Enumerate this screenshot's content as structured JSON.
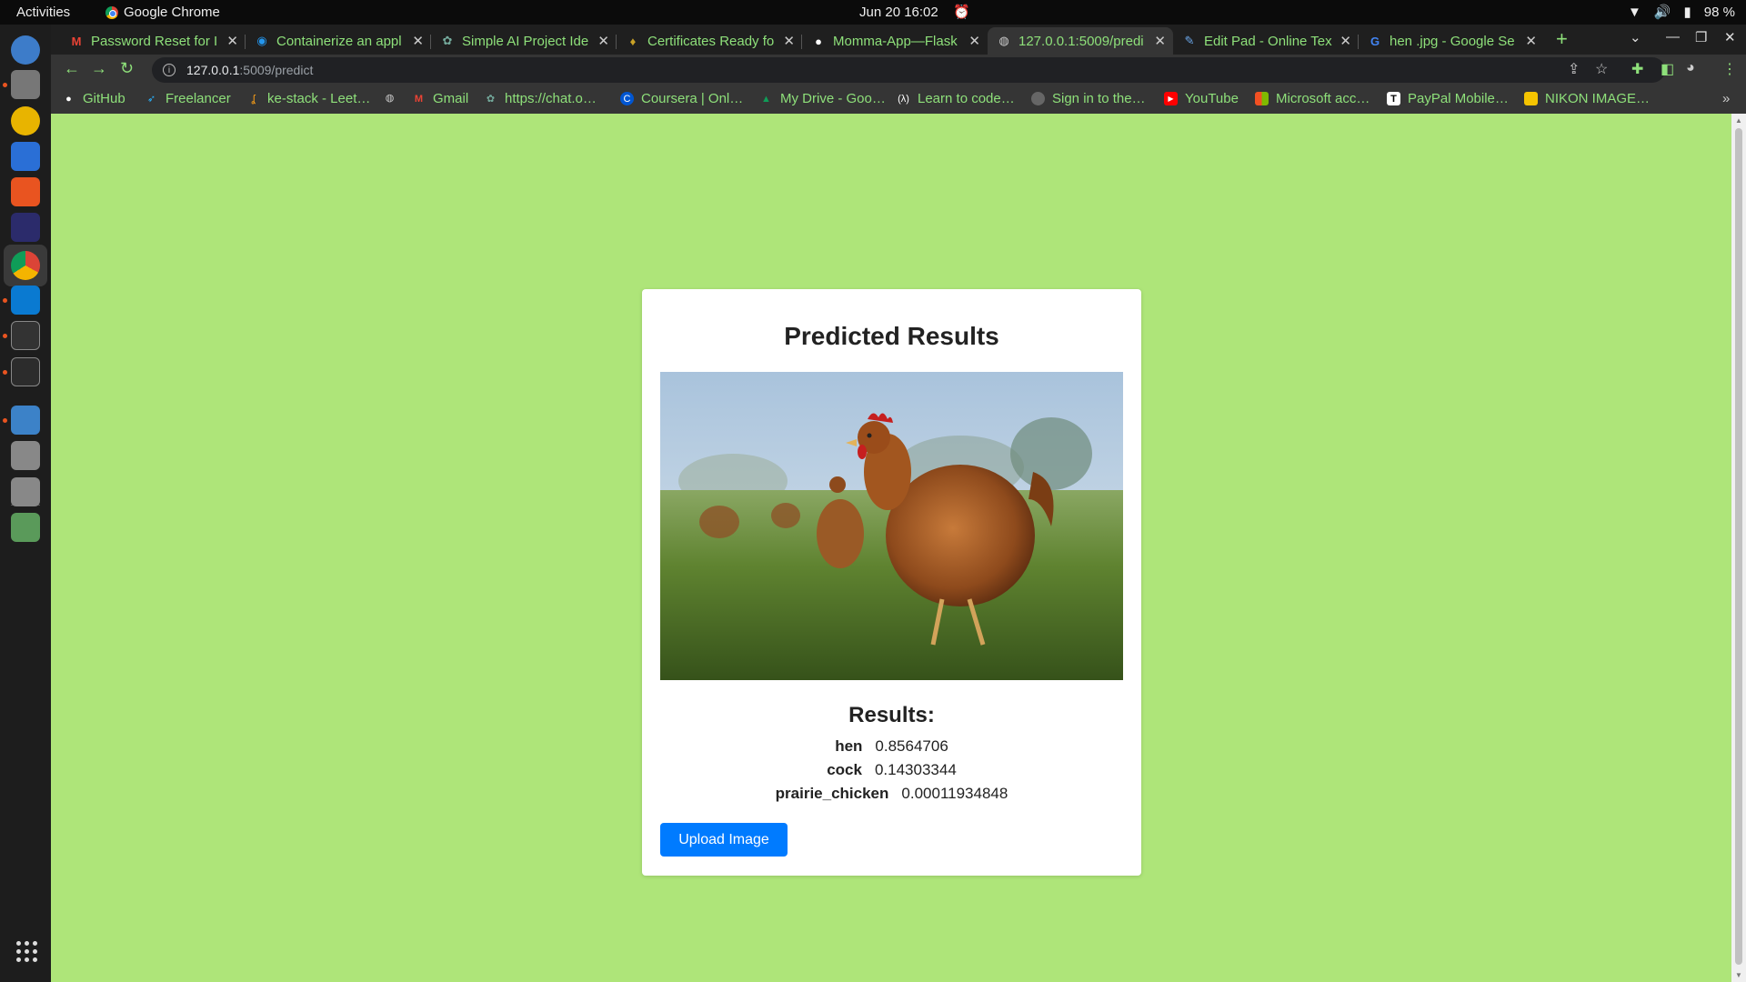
{
  "topbar": {
    "activities": "Activities",
    "app_name": "Google Chrome",
    "datetime": "Jun 20  16:02",
    "battery": "98 %"
  },
  "tabs": [
    {
      "title": "Password Reset for I",
      "icon": "gmail-icon",
      "active": false
    },
    {
      "title": "Containerize an appl",
      "icon": "docker-icon",
      "active": false
    },
    {
      "title": "Simple AI Project Ide",
      "icon": "chatgpt-icon",
      "active": false
    },
    {
      "title": "Certificates Ready fo",
      "icon": "certificate-icon",
      "active": false
    },
    {
      "title": "Momma-App—Flask",
      "icon": "github-icon",
      "active": false
    },
    {
      "title": "127.0.0.1:5009/predi",
      "icon": "globe-icon",
      "active": true
    },
    {
      "title": "Edit Pad - Online Tex",
      "icon": "editpad-icon",
      "active": false
    },
    {
      "title": "hen .jpg - Google Se",
      "icon": "google-icon",
      "active": false
    }
  ],
  "address": {
    "host": "127.0.0.1",
    "path": ":5009/predict"
  },
  "bookmarks": [
    {
      "label": "GitHub",
      "icon": "github-icon"
    },
    {
      "label": "Freelancer",
      "icon": "freelancer-icon"
    },
    {
      "label": "ke-stack - Leet…",
      "icon": "leetcode-icon"
    },
    {
      "label": "",
      "icon": "globe-icon"
    },
    {
      "label": "Gmail",
      "icon": "gmail-icon"
    },
    {
      "label": "https://chat.o…",
      "icon": "chatgpt-icon"
    },
    {
      "label": "Coursera | Onl…",
      "icon": "coursera-icon"
    },
    {
      "label": "My Drive - Goo…",
      "icon": "drive-icon"
    },
    {
      "label": "Learn to code…",
      "icon": "freecodecamp-icon"
    },
    {
      "label": "Sign in to the…",
      "icon": "avatar-icon"
    },
    {
      "label": "YouTube",
      "icon": "youtube-icon"
    },
    {
      "label": "Microsoft acc…",
      "icon": "microsoft-icon"
    },
    {
      "label": "PayPal Mobile…",
      "icon": "paypal-icon"
    },
    {
      "label": "NIKON IMAGE…",
      "icon": "nikon-icon"
    }
  ],
  "page": {
    "title": "Predicted Results",
    "image_alt": "hen",
    "results_heading": "Results:",
    "results": [
      {
        "label": "hen",
        "score": "0.8564706"
      },
      {
        "label": "cock",
        "score": "0.14303344"
      },
      {
        "label": "prairie_chicken",
        "score": "0.00011934848"
      }
    ],
    "upload_label": "Upload Image"
  },
  "colors": {
    "page_bg": "#aee579",
    "button": "#007bff",
    "chrome_accent": "#8ee07a"
  }
}
